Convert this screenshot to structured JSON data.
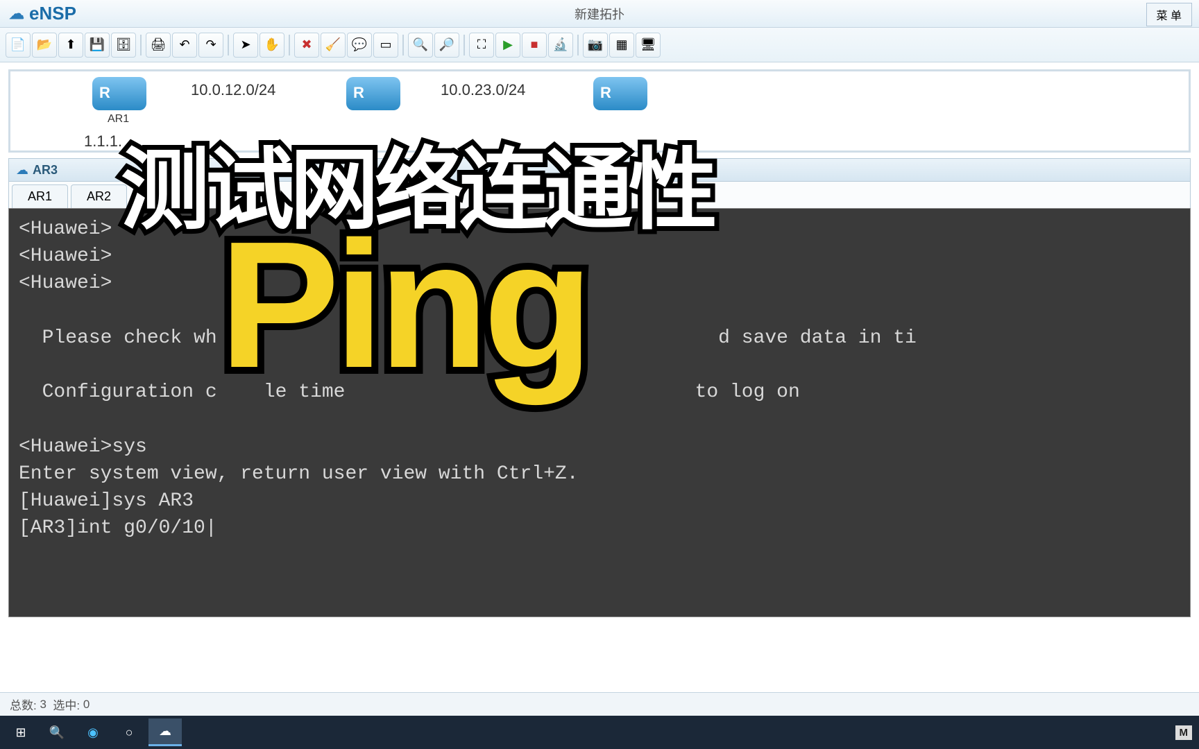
{
  "app": {
    "name": "eNSP",
    "title": "新建拓扑",
    "menu_label": "菜 单"
  },
  "topology": {
    "router1_label": "AR1",
    "net1": "10.0.12.0/24",
    "net2": "10.0.23.0/24",
    "ip1": "1.1.1."
  },
  "term_window": {
    "title": "AR3",
    "tabs": [
      "AR1",
      "AR2"
    ]
  },
  "terminal_text": "<Huawei>\n<Huawei>\n<Huawei>\n\n  Please check wh                                           d save data in ti\n\n  Configuration c    le time                              to log on\n\n<Huawei>sys\nEnter system view, return user view with Ctrl+Z.\n[Huawei]sys AR3\n[AR3]int g0/0/10|",
  "status": {
    "total_label": "总数:",
    "total": "3",
    "selected_label": "选中:",
    "selected": "0"
  },
  "overlay": {
    "title": "测试网络连通性",
    "word": "Ping"
  },
  "tray": {
    "indicator": "M"
  },
  "toolbar_icons": [
    "new",
    "open",
    "upload",
    "save",
    "saveall",
    "print",
    "undo",
    "redo",
    "pointer",
    "hand",
    "delete",
    "erase",
    "note",
    "rect",
    "zoomin",
    "zoomout",
    "fit",
    "play",
    "stop",
    "inspect",
    "capture",
    "grid",
    "screen"
  ]
}
